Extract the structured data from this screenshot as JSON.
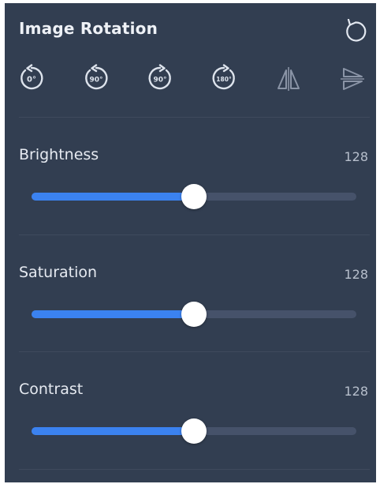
{
  "panel": {
    "title": "Image Rotation",
    "reset_icon": "rotate-ccw-icon"
  },
  "rotation_tools": [
    {
      "name": "rotate-0",
      "label": "0°",
      "icon": "rotate-left-icon"
    },
    {
      "name": "rotate-90-left",
      "label": "90°",
      "icon": "rotate-left-icon"
    },
    {
      "name": "rotate-90-right",
      "label": "90°",
      "icon": "rotate-right-icon"
    },
    {
      "name": "rotate-180",
      "label": "180°",
      "icon": "rotate-right-icon"
    },
    {
      "name": "flip-horizontal",
      "label": "",
      "icon": "flip-horizontal-icon"
    },
    {
      "name": "flip-vertical",
      "label": "",
      "icon": "flip-vertical-icon"
    }
  ],
  "sliders": [
    {
      "label": "Brightness",
      "value": "128",
      "fraction": 0.5
    },
    {
      "label": "Saturation",
      "value": "128",
      "fraction": 0.5
    },
    {
      "label": "Contrast",
      "value": "128",
      "fraction": 0.5
    }
  ],
  "colors": {
    "panel_bg": "#323e51",
    "accent": "#3b82f0",
    "track": "#46526a",
    "icon": "#dde3ec",
    "icon_dim": "#8a94a6"
  }
}
